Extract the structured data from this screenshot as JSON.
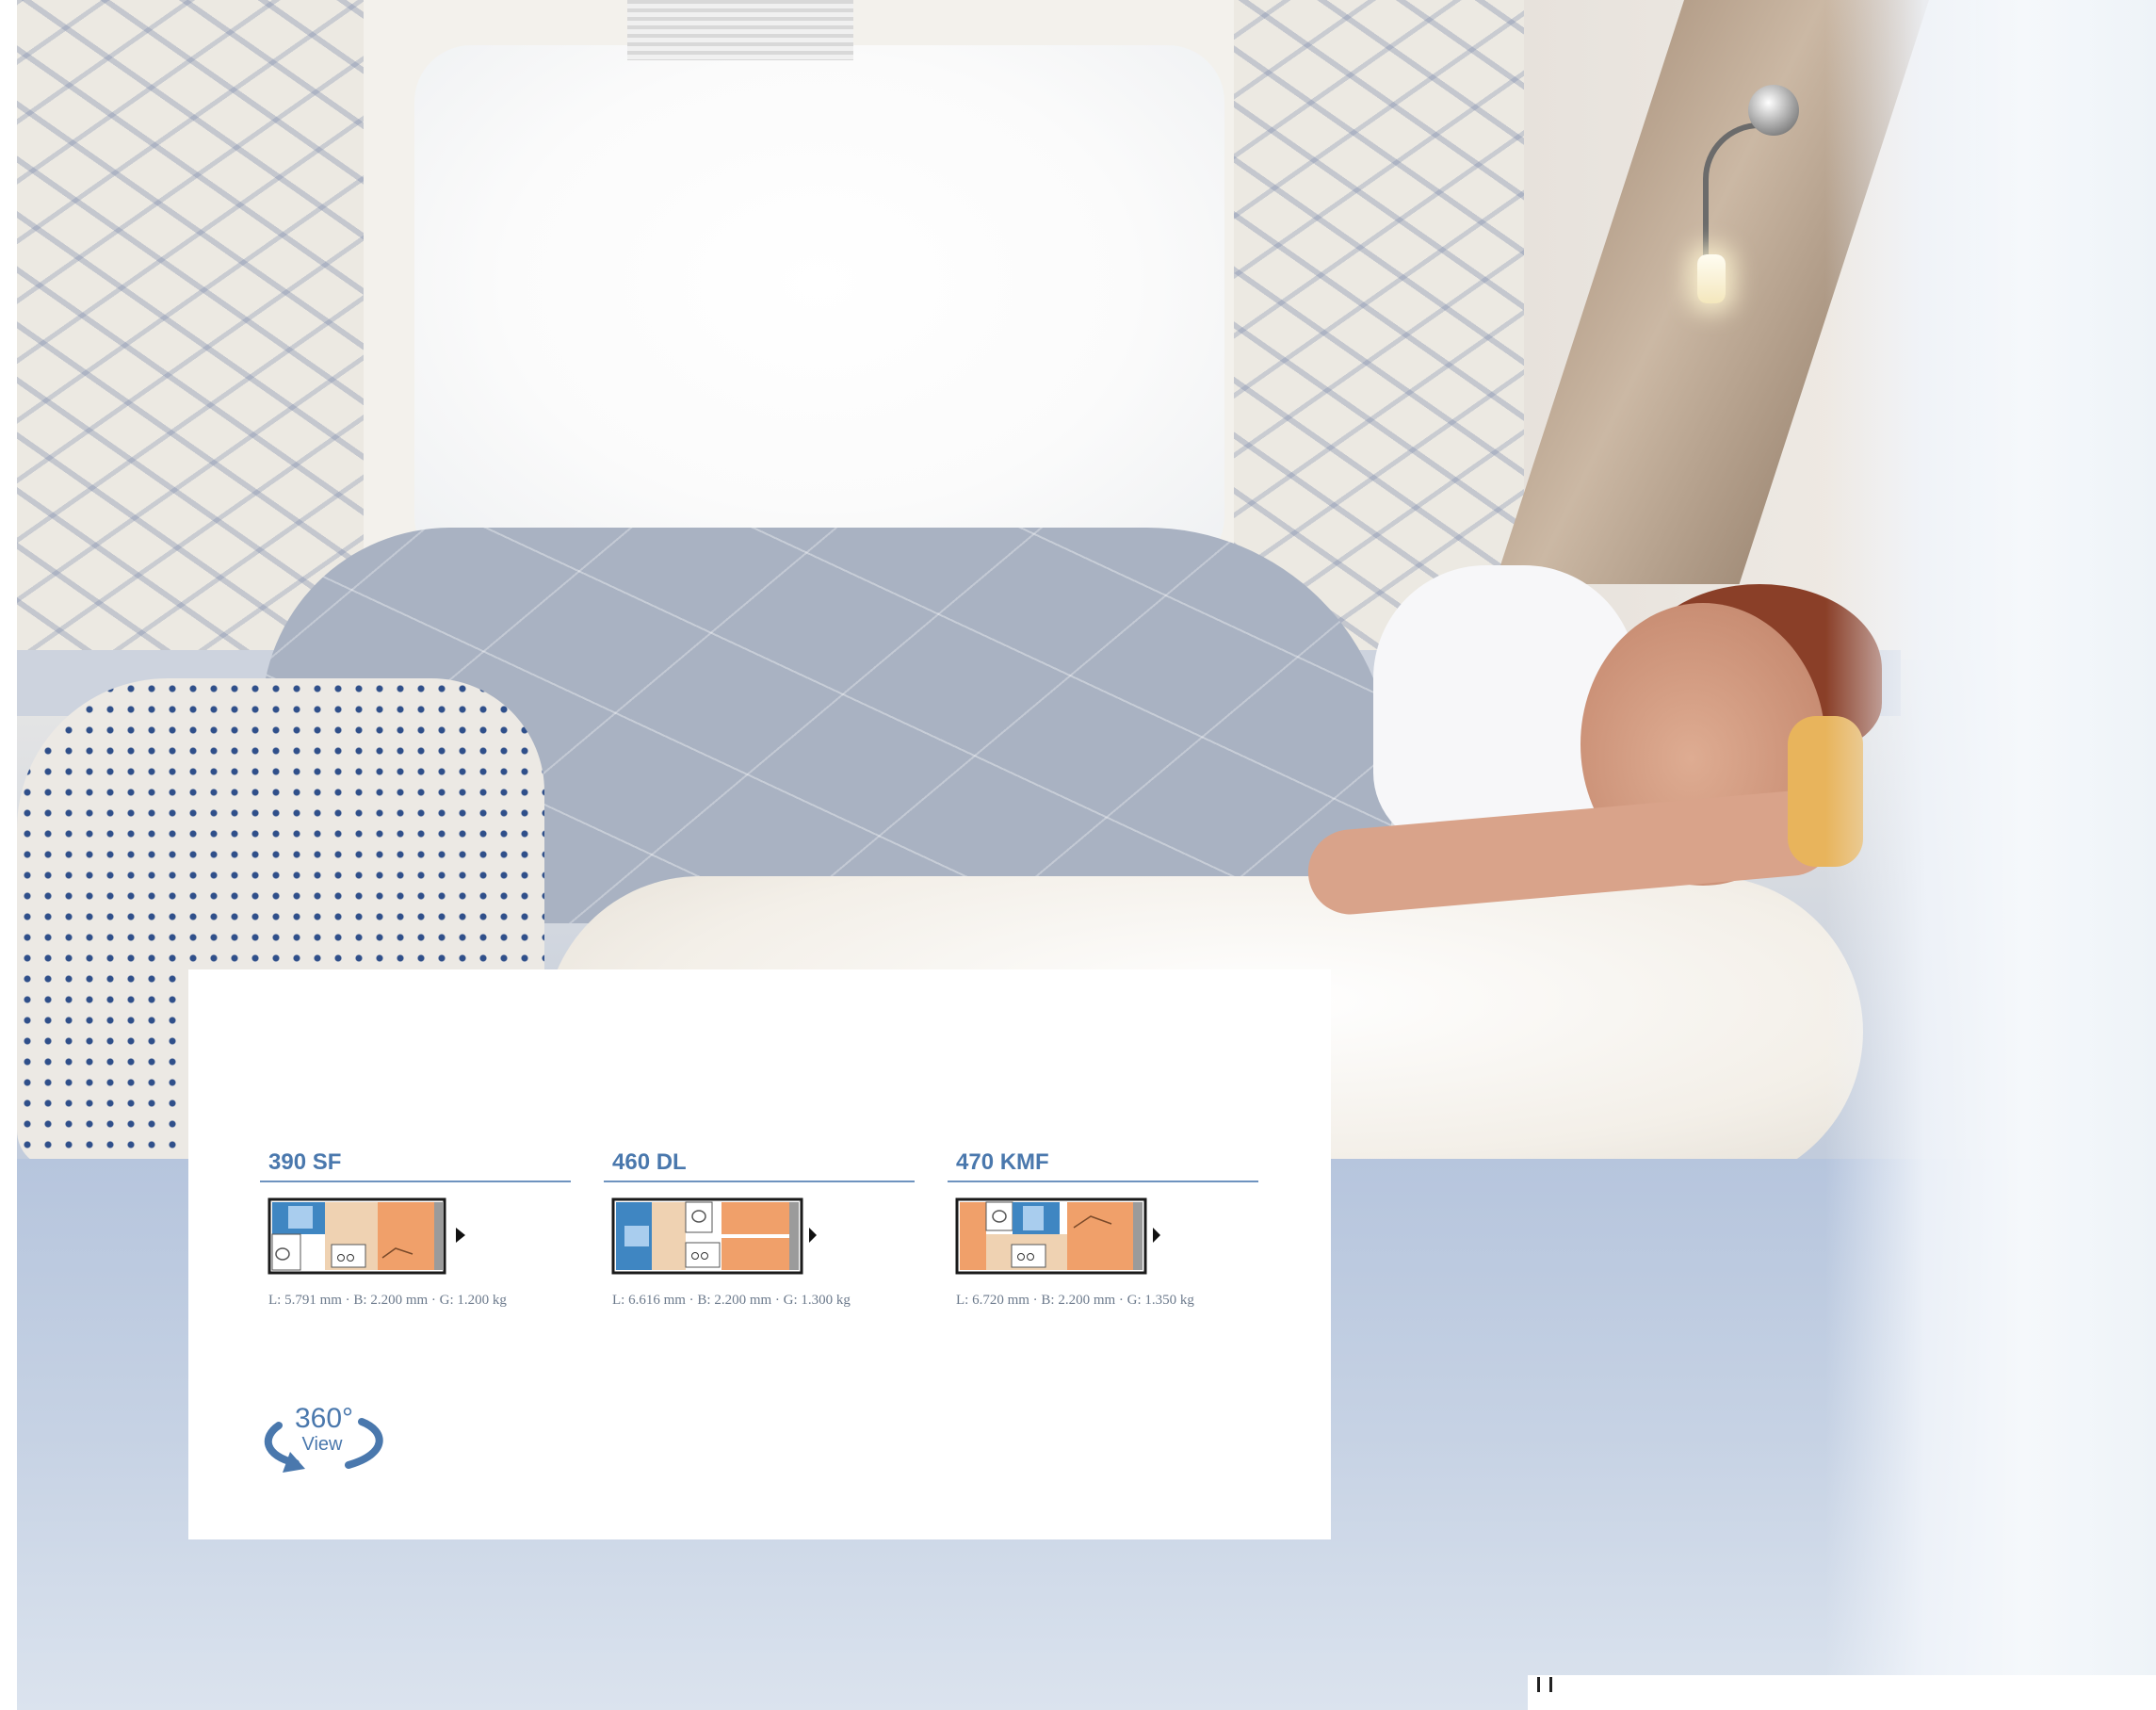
{
  "panel": {
    "models": [
      {
        "name": "390 SF",
        "spec": "L: 5.791 mm · B: 2.200 mm · G: 1.200 kg",
        "layout": "390sf"
      },
      {
        "name": "460 DL",
        "spec": "L: 6.616 mm · B: 2.200 mm · G: 1.300 kg",
        "layout": "460dl"
      },
      {
        "name": "470 KMF",
        "spec": "L: 6.720 mm · B: 2.200 mm · G: 1.350 kg",
        "layout": "470kmf"
      }
    ],
    "view360": {
      "degrees": "360°",
      "label": "View"
    }
  },
  "colors": {
    "accent": "#4a78ad",
    "seating_blue": "#3f86c2",
    "bed_orange": "#f0a06a",
    "kitchen_beige": "#efd2b2"
  },
  "icons": [
    "360-view-icon",
    "floorplan-diagram",
    "direction-arrow-icon"
  ]
}
